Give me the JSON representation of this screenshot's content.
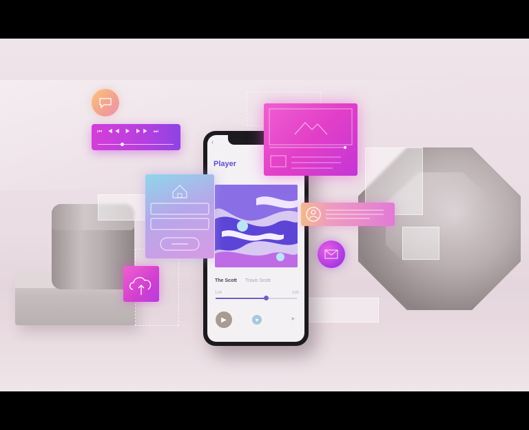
{
  "scene": {
    "phone": {
      "screen_title": "Player",
      "song_title": "The Scott",
      "artist": "Travis Scott",
      "time_elapsed": "1:24",
      "time_total": "3:20",
      "progress": 0.62
    },
    "icons": {
      "chat": "chat-bubble-icon",
      "media": "media-controls-icon",
      "video": "video-player-icon",
      "home": "home-icon",
      "upload": "cloud-upload-icon",
      "profile": "user-profile-icon",
      "mail": "mail-icon"
    },
    "colors": {
      "accent": "#5e4fd1",
      "magenta": "#e23fc8",
      "violet": "#8f43e4",
      "background": "#efe4ea"
    }
  }
}
